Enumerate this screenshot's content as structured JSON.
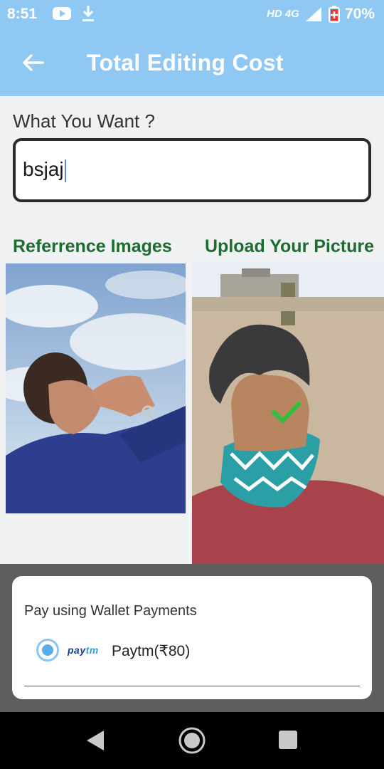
{
  "status_bar": {
    "time": "8:51",
    "network": "HD 4G",
    "battery": "70%",
    "icons": [
      "youtube-icon",
      "download-icon",
      "signal-icon",
      "battery-charging-icon"
    ]
  },
  "app_bar": {
    "title": "Total Editing Cost",
    "back_icon": "arrow-back-icon"
  },
  "form": {
    "prompt_label": "What You Want ?",
    "input_value": "bsjaj"
  },
  "images": {
    "reference_title": "Referrence Images",
    "upload_title": "Upload Your Picture"
  },
  "payment_sheet": {
    "heading": "Pay using Wallet Payments",
    "options": [
      {
        "logo_text_a": "pay",
        "logo_text_b": "tm",
        "label": "Paytm(₹80)",
        "selected": true
      }
    ]
  },
  "nav_bar": {
    "buttons": [
      "back-triangle-icon",
      "home-circle-icon",
      "recents-square-icon"
    ]
  },
  "colors": {
    "app_bar": "#90c8f4",
    "section_title": "#1e6b2f",
    "scrim": "#5f5e5e",
    "radio_accent": "#5aaee8"
  }
}
